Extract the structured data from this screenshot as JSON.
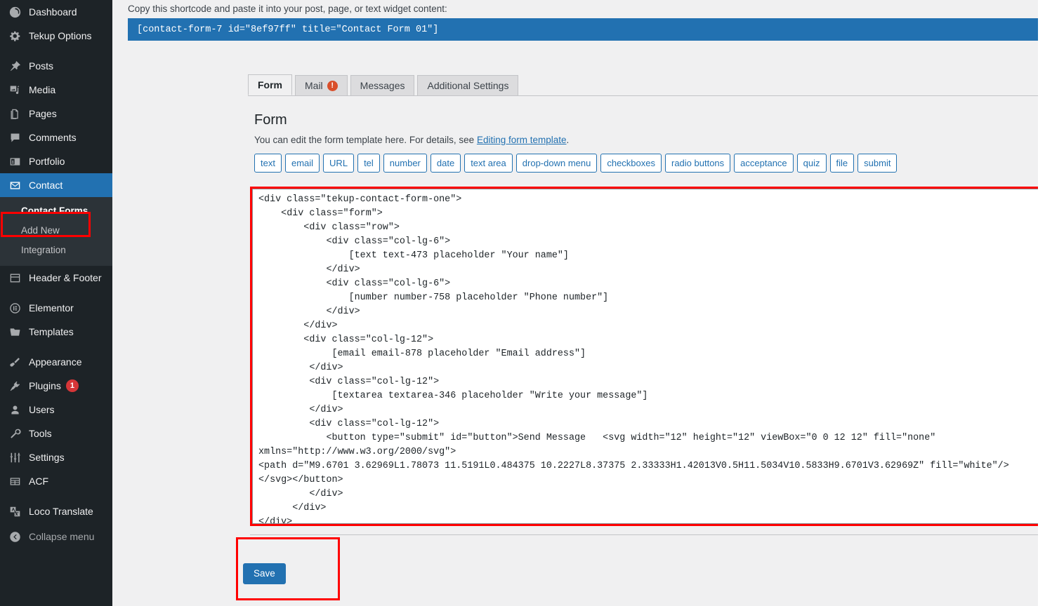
{
  "sidebar": {
    "items": [
      {
        "label": "Dashboard",
        "icon": "dashboard-icon",
        "type": "top"
      },
      {
        "label": "Tekup Options",
        "icon": "gear-icon",
        "type": "top"
      },
      {
        "label": "Posts",
        "icon": "pin-icon",
        "type": "top"
      },
      {
        "label": "Media",
        "icon": "media-icon",
        "type": "top"
      },
      {
        "label": "Pages",
        "icon": "pages-icon",
        "type": "top"
      },
      {
        "label": "Comments",
        "icon": "comment-icon",
        "type": "top"
      },
      {
        "label": "Portfolio",
        "icon": "portfolio-icon",
        "type": "top"
      },
      {
        "label": "Contact",
        "icon": "envelope-icon",
        "type": "current"
      },
      {
        "label": "Header & Footer",
        "icon": "header-footer-icon",
        "type": "top"
      },
      {
        "label": "Elementor",
        "icon": "elementor-icon",
        "type": "top"
      },
      {
        "label": "Templates",
        "icon": "folder-icon",
        "type": "top"
      },
      {
        "label": "Appearance",
        "icon": "brush-icon",
        "type": "top"
      },
      {
        "label": "Plugins",
        "icon": "plug-icon",
        "type": "top",
        "badge": "1"
      },
      {
        "label": "Users",
        "icon": "user-icon",
        "type": "top"
      },
      {
        "label": "Tools",
        "icon": "wrench-icon",
        "type": "top"
      },
      {
        "label": "Settings",
        "icon": "sliders-icon",
        "type": "top"
      },
      {
        "label": "ACF",
        "icon": "acf-grid-icon",
        "type": "top"
      },
      {
        "label": "Loco Translate",
        "icon": "translate-icon",
        "type": "top"
      },
      {
        "label": "Collapse menu",
        "icon": "collapse-arrow-icon",
        "type": "dim"
      }
    ],
    "submenu": [
      {
        "label": "Contact Forms",
        "active": true
      },
      {
        "label": "Add New",
        "active": false
      },
      {
        "label": "Integration",
        "active": false
      }
    ]
  },
  "shortcode": {
    "instruction": "Copy this shortcode and paste it into your post, page, or text widget content:",
    "value": "[contact-form-7 id=\"8ef97ff\" title=\"Contact Form 01\"]"
  },
  "tabs": [
    {
      "label": "Form",
      "active": true,
      "alert": ""
    },
    {
      "label": "Mail",
      "active": false,
      "alert": "!"
    },
    {
      "label": "Messages",
      "active": false,
      "alert": ""
    },
    {
      "label": "Additional Settings",
      "active": false,
      "alert": ""
    }
  ],
  "panel": {
    "heading": "Form",
    "description_before": "You can edit the form template here. For details, see ",
    "description_link": "Editing form template",
    "description_after": "."
  },
  "tag_buttons": [
    "text",
    "email",
    "URL",
    "tel",
    "number",
    "date",
    "text area",
    "drop-down menu",
    "checkboxes",
    "radio buttons",
    "acceptance",
    "quiz",
    "file",
    "submit"
  ],
  "editor": {
    "content": "<div class=\"tekup-contact-form-one\">\n    <div class=\"form\">\n        <div class=\"row\">\n            <div class=\"col-lg-6\">\n                [text text-473 placeholder \"Your name\"]\n            </div>\n            <div class=\"col-lg-6\">\n                [number number-758 placeholder \"Phone number\"]\n            </div>\n        </div>\n        <div class=\"col-lg-12\">\n             [email email-878 placeholder \"Email address\"]\n         </div>\n         <div class=\"col-lg-12\">\n             [textarea textarea-346 placeholder \"Write your message\"]\n         </div>\n         <div class=\"col-lg-12\">\n            <button type=\"submit\" id=\"button\">Send Message   <svg width=\"12\" height=\"12\" viewBox=\"0 0 12 12\" fill=\"none\" xmlns=\"http://www.w3.org/2000/svg\">\n<path d=\"M9.6701 3.62969L1.78073 11.5191L0.484375 10.2227L8.37375 2.33333H1.42013V0.5H11.5034V10.5833H9.6701V3.62969Z\" fill=\"white\"/>\n</svg></button>\n         </div>\n      </div>\n</div>"
  },
  "footer": {
    "save_label": "Save"
  },
  "colors": {
    "admin_bg": "#1d2327",
    "submenu_bg": "#2c3338",
    "accent_blue": "#2271b1",
    "highlight_red": "#ff0000",
    "badge_red": "#d63638",
    "alert_orange": "#d94f2b",
    "content_bg": "#f0f0f1"
  }
}
